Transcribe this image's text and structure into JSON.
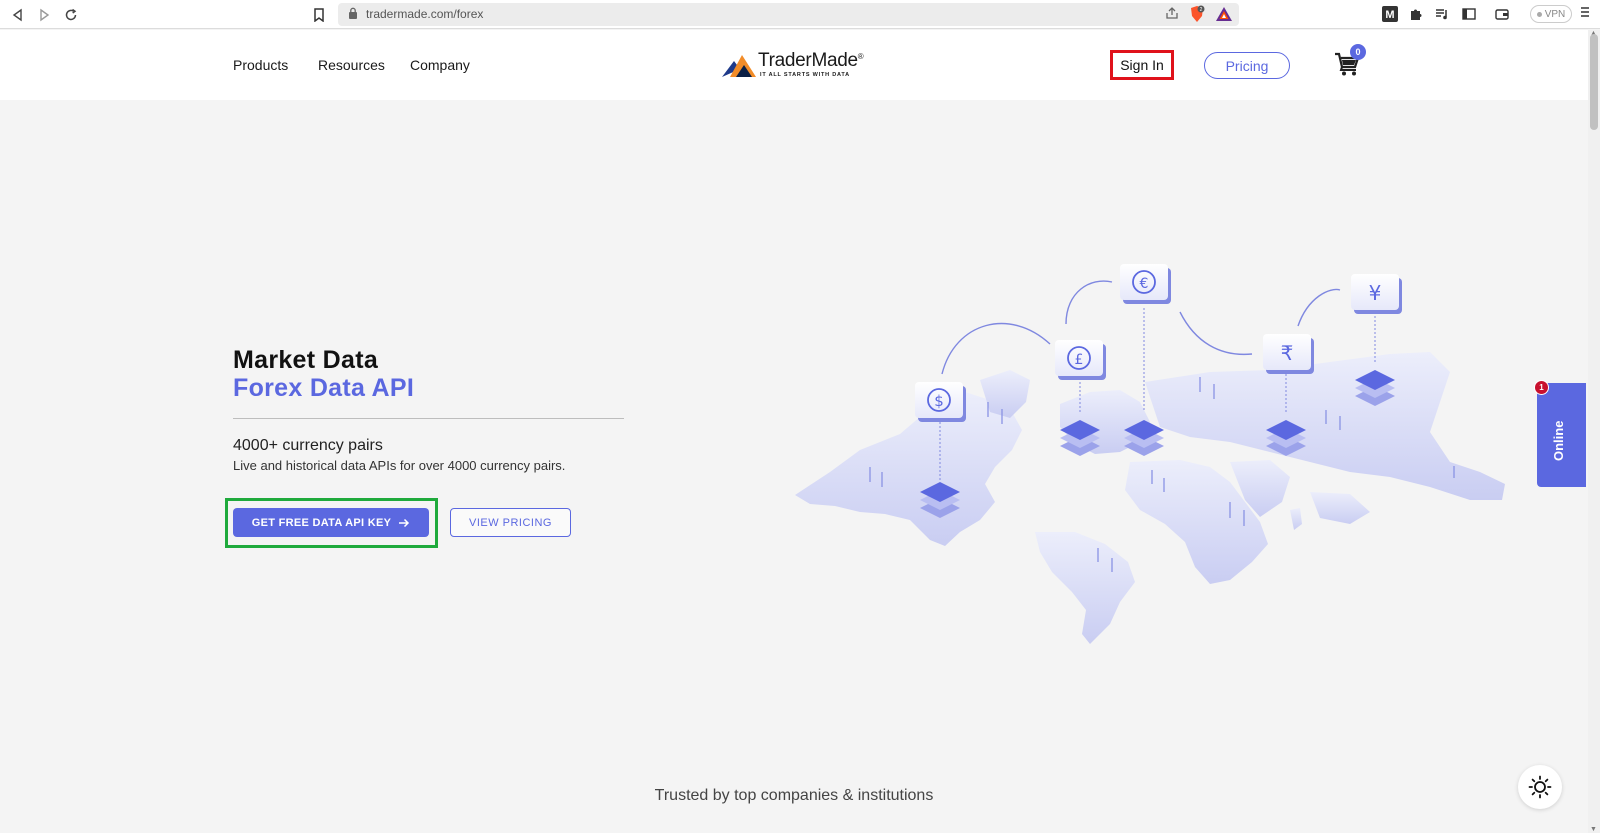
{
  "browser": {
    "url": "tradermade.com/forex",
    "vpn_label": "VPN",
    "brave_badge": "2"
  },
  "header": {
    "nav": [
      {
        "label": "Products"
      },
      {
        "label": "Resources"
      },
      {
        "label": "Company"
      }
    ],
    "logo": {
      "name": "TraderMade",
      "mark": "®",
      "tagline": "IT ALL STARTS WITH DATA"
    },
    "sign_in": "Sign In",
    "pricing": "Pricing",
    "cart_count": "0"
  },
  "hero": {
    "title": "Market Data",
    "subtitle": "Forex Data API",
    "heading": "4000+ currency pairs",
    "description": "Live and historical data APIs for over 4000 currency pairs.",
    "primary_cta": "GET FREE DATA API KEY",
    "secondary_cta": "VIEW PRICING"
  },
  "illustration": {
    "currency_symbols": [
      "$",
      "£",
      "€",
      "₹",
      "¥"
    ]
  },
  "chat_widget": {
    "label": "Online",
    "badge": "1"
  },
  "footer_teaser": "Trusted by top companies & institutions",
  "colors": {
    "accent": "#5b68e0",
    "highlight_red": "#e0121b",
    "highlight_green": "#1faa3c",
    "background": "#f4f4f4"
  }
}
